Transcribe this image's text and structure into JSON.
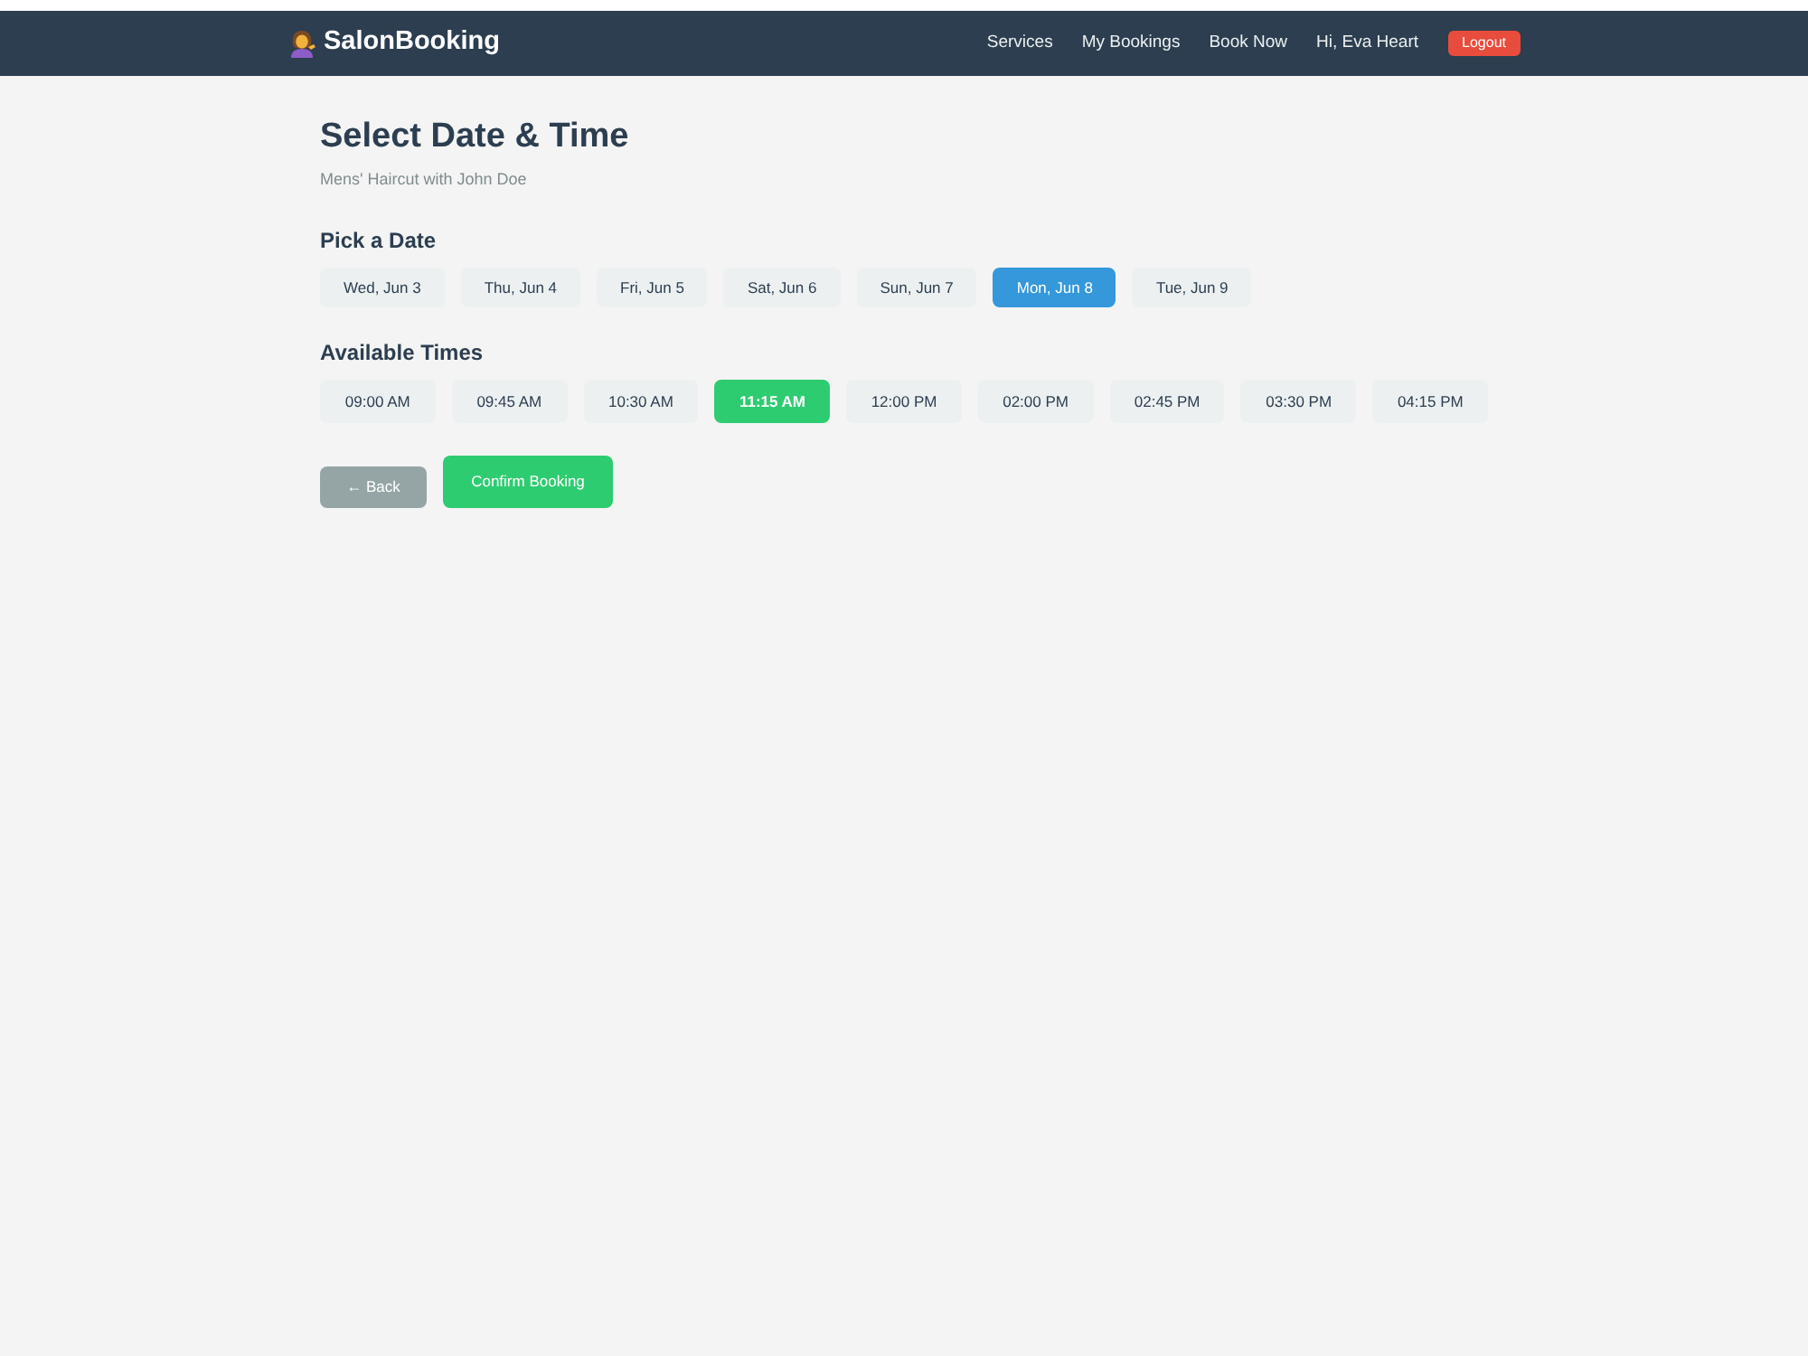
{
  "nav": {
    "brand": "SalonBooking",
    "links": [
      "Services",
      "My Bookings",
      "Book Now"
    ],
    "greeting": "Hi, Eva Heart",
    "logout": "Logout"
  },
  "page": {
    "title": "Select Date & Time",
    "subtitle": "Mens' Haircut with John Doe"
  },
  "dates": {
    "heading": "Pick a Date",
    "items": [
      {
        "label": "Wed, Jun 3",
        "selected": false
      },
      {
        "label": "Thu, Jun 4",
        "selected": false
      },
      {
        "label": "Fri, Jun 5",
        "selected": false
      },
      {
        "label": "Sat, Jun 6",
        "selected": false
      },
      {
        "label": "Sun, Jun 7",
        "selected": false
      },
      {
        "label": "Mon, Jun 8",
        "selected": true
      },
      {
        "label": "Tue, Jun 9",
        "selected": false
      }
    ]
  },
  "times": {
    "heading": "Available Times",
    "items": [
      {
        "label": "09:00 AM",
        "selected": false
      },
      {
        "label": "09:45 AM",
        "selected": false
      },
      {
        "label": "10:30 AM",
        "selected": false
      },
      {
        "label": "11:15 AM",
        "selected": true
      },
      {
        "label": "12:00 PM",
        "selected": false
      },
      {
        "label": "02:00 PM",
        "selected": false
      },
      {
        "label": "02:45 PM",
        "selected": false
      },
      {
        "label": "03:30 PM",
        "selected": false
      },
      {
        "label": "04:15 PM",
        "selected": false
      }
    ]
  },
  "actions": {
    "back": "← Back",
    "confirm": "Confirm Booking"
  }
}
